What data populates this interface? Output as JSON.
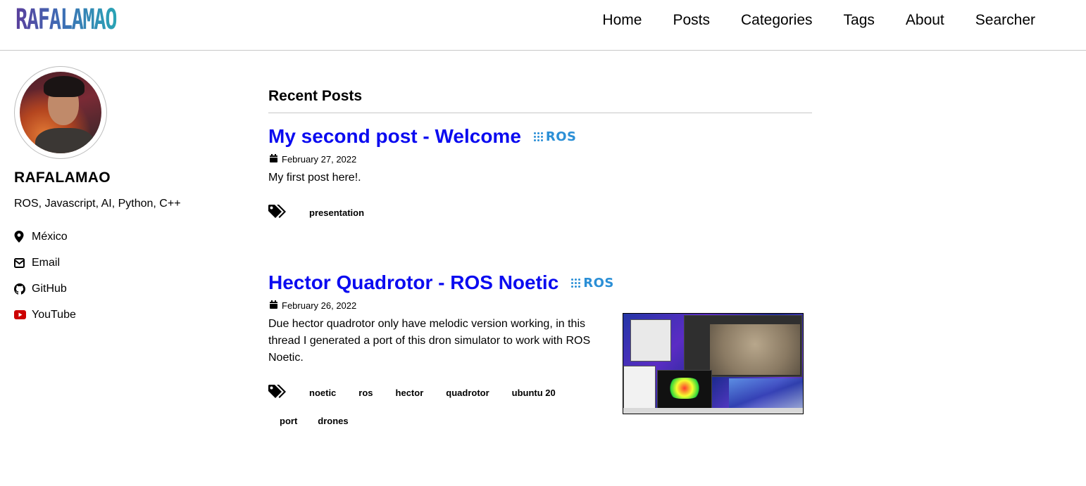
{
  "header": {
    "logo": "RAFALAMAO",
    "nav": [
      "Home",
      "Posts",
      "Categories",
      "Tags",
      "About",
      "Searcher"
    ]
  },
  "sidebar": {
    "name": "RAFALAMAO",
    "bio": "ROS, Javascript, AI, Python, C++",
    "links": [
      {
        "label": "México",
        "icon": "map-pin-icon"
      },
      {
        "label": "Email",
        "icon": "envelope-icon"
      },
      {
        "label": "GitHub",
        "icon": "github-icon"
      },
      {
        "label": "YouTube",
        "icon": "youtube-icon",
        "color": "#cc0000"
      }
    ]
  },
  "main": {
    "section_title": "Recent Posts",
    "posts": [
      {
        "title": "My second post - Welcome",
        "category": "ROS",
        "date": "February 27, 2022",
        "summary": "My first post here!.",
        "tags": [
          "presentation"
        ]
      },
      {
        "title": "Hector Quadrotor - ROS Noetic",
        "category": "ROS",
        "date": "February 26, 2022",
        "summary": "Due hector quadrotor only have melodic version working, in this thread I generated a port of this dron simulator to work with ROS Noetic.",
        "tags": [
          "noetic",
          "ros",
          "hector",
          "quadrotor",
          "ubuntu 20",
          "port",
          "drones"
        ],
        "thumbnail": "simulator-screenshot"
      }
    ]
  },
  "colors": {
    "post_title": "#0b0bf0",
    "ros_badge": "#2b8fd6",
    "divider": "#c8c8c8"
  }
}
